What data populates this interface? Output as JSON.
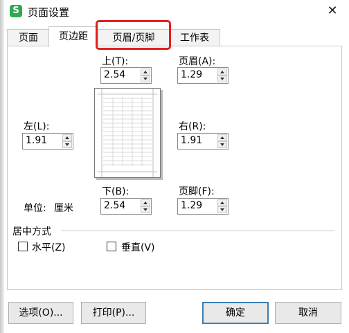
{
  "window": {
    "title": "页面设置",
    "app_icon_letter": "S",
    "close_glyph": "✕"
  },
  "tabs": [
    {
      "label": "页面"
    },
    {
      "label": "页边距",
      "active": true
    },
    {
      "label": "页眉/页脚",
      "highlighted": true
    },
    {
      "label": "工作表"
    }
  ],
  "margins": {
    "top": {
      "label": "上(T):",
      "value": "2.54"
    },
    "header": {
      "label": "页眉(A):",
      "value": "1.29"
    },
    "left": {
      "label": "左(L):",
      "value": "1.91"
    },
    "right": {
      "label": "右(R):",
      "value": "1.91"
    },
    "bottom": {
      "label": "下(B):",
      "value": "2.54"
    },
    "footer": {
      "label": "页脚(F):",
      "value": "1.29"
    }
  },
  "unit": {
    "label": "单位:",
    "value": "厘米"
  },
  "centering": {
    "section_label": "居中方式",
    "horizontal": {
      "label": "水平(Z)",
      "checked": false
    },
    "vertical": {
      "label": "垂直(V)",
      "checked": false
    }
  },
  "buttons": {
    "options": "选项(O)...",
    "print": "打印(P)...",
    "ok": "确定",
    "cancel": "取消"
  },
  "colors": {
    "highlight_red": "#e0201c",
    "default_button_border": "#3c7fb1",
    "app_icon_green": "#2fa84f"
  }
}
